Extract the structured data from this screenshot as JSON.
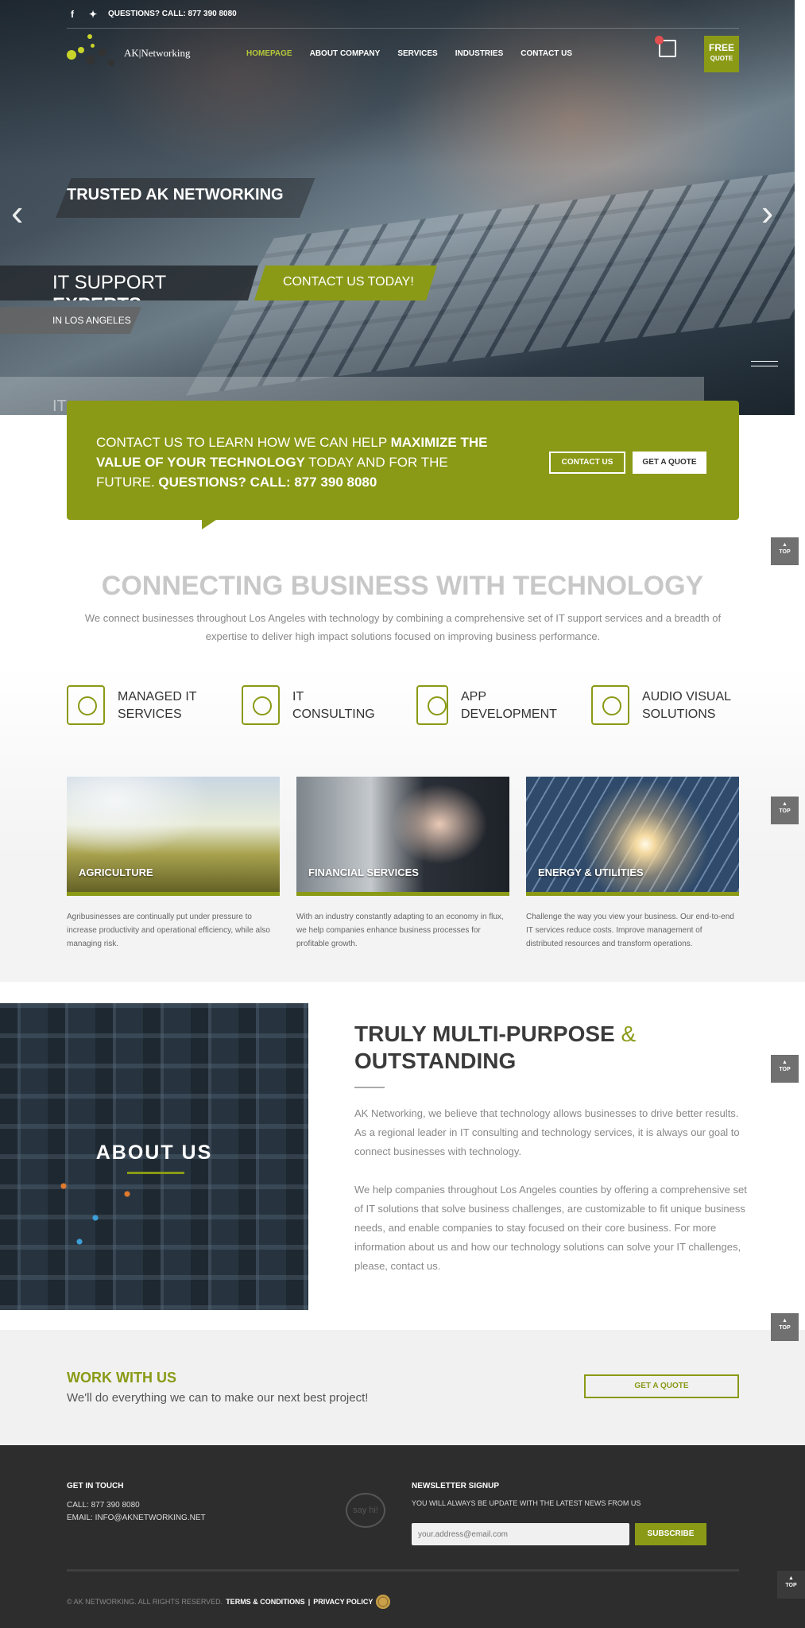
{
  "topbar": {
    "facebook_icon": "facebook-icon",
    "twitter_icon": "twitter-icon",
    "phone_text": "QUESTIONS? CALL: 877 390 8080"
  },
  "logo": {
    "text": "AK|Networking"
  },
  "nav": {
    "items": [
      "HOMEPAGE",
      "ABOUT COMPANY",
      "SERVICES",
      "INDUSTRIES",
      "CONTACT US"
    ],
    "active": "HOMEPAGE"
  },
  "header": {
    "free_quote_line1": "FREE",
    "free_quote_line2": "QUOTE",
    "cart_icon": "shopping-bag-icon"
  },
  "hero": {
    "caption1": "TRUSTED AK NETWORKING",
    "caption2_a": "IT SUPPORT ",
    "caption2_b": "EXPERTS",
    "caption3": "CONTACT US TODAY!",
    "caption4": "IN LOS ANGELES",
    "ghost_text": "IT",
    "prev_icon": "chevron-left-icon",
    "next_icon": "chevron-right-icon"
  },
  "cta": {
    "text_a": "CONTACT US TO LEARN HOW WE CAN HELP ",
    "text_b": "MAXIMIZE THE VALUE OF YOUR TECHNOLOGY",
    "text_c": " TODAY AND FOR THE FUTURE. ",
    "text_d": "QUESTIONS? CALL: 877 390 8080",
    "contact_button": "CONTACT US",
    "quote_button": "GET A QUOTE"
  },
  "top_label": "TOP",
  "connecting": {
    "title": "CONNECTING BUSINESS WITH TECHNOLOGY",
    "subtitle": "We connect businesses throughout Los Angeles with technology by combining a comprehensive set of IT support services and a breadth of expertise to deliver high impact solutions focused on improving business performance."
  },
  "services": [
    {
      "label": "MANAGED IT SERVICES",
      "icon": "presenter-chart-icon"
    },
    {
      "label": "IT CONSULTING",
      "icon": "consulting-folder-icon"
    },
    {
      "label": "APP DEVELOPMENT",
      "icon": "app-settings-icon"
    },
    {
      "label": "AUDIO VISUAL SOLUTIONS",
      "icon": "monitor-graph-icon"
    }
  ],
  "industries": [
    {
      "title": "AGRICULTURE",
      "text": "Agribusinesses are continually put under pressure to increase productivity and operational efficiency, while also managing risk."
    },
    {
      "title": "FINANCIAL SERVICES",
      "text": "With an industry constantly adapting to an economy in flux, we help companies enhance business processes for profitable growth."
    },
    {
      "title": "ENERGY & UTILITIES",
      "text": "Challenge the way you view your business. Our end-to-end IT services reduce costs. Improve management of distributed resources and transform operations."
    }
  ],
  "about": {
    "image_title": "ABOUT US",
    "title_a": "TRULY MULTI-PURPOSE ",
    "title_amp": "&",
    "title_b": "OUTSTANDING",
    "p1": "AK Networking, we believe that technology allows businesses to drive better results. As a regional leader in IT consulting and technology services, it is always our goal to connect businesses with technology.",
    "p2": "We help companies throughout Los Angeles counties by offering a comprehensive set of IT solutions that solve business challenges, are customizable to fit unique business needs, and enable companies to stay focused on their core business. For more information about us and how our technology solutions can solve your IT challenges, please, contact us."
  },
  "work": {
    "title": "WORK WITH US",
    "text": "We'll do everything we can to make our next best project!",
    "button": "GET A QUOTE"
  },
  "footer": {
    "get_in_touch": "GET IN TOUCH",
    "call": "CALL: 877 390 8080",
    "email": "EMAIL: INFO@AKNETWORKING.NET",
    "bubble": "say hi!",
    "newsletter_title": "NEWSLETTER SIGNUP",
    "newsletter_text": "YOU WILL ALWAYS BE UPDATE WITH THE LATEST NEWS FROM US",
    "email_placeholder": "your.address@email.com",
    "subscribe": "SUBSCRIBE",
    "copyright": "© AK NETWORKING. ALL RIGHTS RESERVED.",
    "terms": "TERMS & CONDITIONS",
    "sep": "|",
    "privacy": "PRIVACY POLICY"
  }
}
